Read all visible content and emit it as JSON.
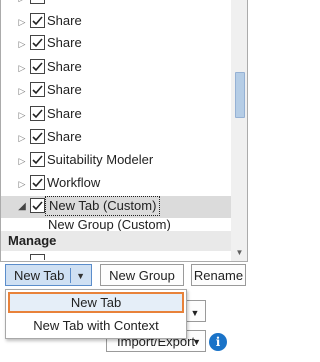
{
  "tree": {
    "items": [
      {
        "label": "Share",
        "checked": true,
        "expander": "collapsed"
      },
      {
        "label": "Share",
        "checked": true,
        "expander": "collapsed"
      },
      {
        "label": "Share",
        "checked": true,
        "expander": "collapsed"
      },
      {
        "label": "Share",
        "checked": true,
        "expander": "collapsed"
      },
      {
        "label": "Share",
        "checked": true,
        "expander": "collapsed"
      },
      {
        "label": "Share",
        "checked": true,
        "expander": "collapsed"
      },
      {
        "label": "Suitability Modeler",
        "checked": true,
        "expander": "collapsed"
      },
      {
        "label": "Workflow",
        "checked": true,
        "expander": "collapsed"
      },
      {
        "label": "New Tab (Custom)",
        "checked": true,
        "expander": "expanded",
        "selected": true
      }
    ],
    "group_label": "New Group (Custom)",
    "section_header": "Manage"
  },
  "buttons": {
    "new_tab": "New Tab",
    "new_group": "New Group",
    "rename": "Rename",
    "import_export": "Import/Export"
  },
  "dropdown_menu": {
    "items": [
      "New Tab",
      "New Tab with Context"
    ],
    "highlighted_index": 0
  },
  "icons": {
    "collapsed": "triangle-right-icon",
    "expanded": "triangle-down-icon",
    "info": "info-icon"
  },
  "colors": {
    "accent_highlight": "#e8823a",
    "split_button_bg": "#cfe0f3",
    "info_blue": "#1a73c8"
  }
}
